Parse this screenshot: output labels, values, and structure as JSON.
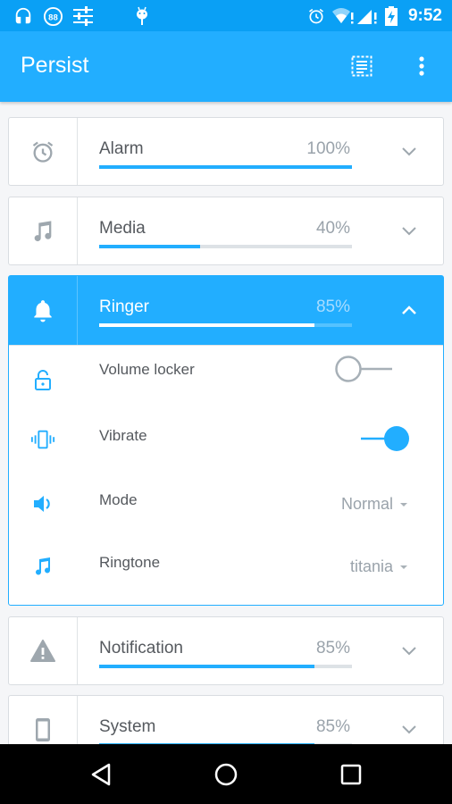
{
  "status_bar": {
    "time": "9:52",
    "notification_icons": [
      "headphones-icon",
      "88-badge-icon",
      "equalizer-icon",
      "android-icon"
    ],
    "badge_number": "88",
    "system_icons": [
      "alarm-icon",
      "wifi-icon",
      "signal-icon",
      "battery-charging-icon"
    ]
  },
  "app_bar": {
    "title": "Persist",
    "actions": [
      "select-all-icon",
      "more-vert-icon"
    ]
  },
  "accent_color": "#22aeff",
  "streams": [
    {
      "label": "Alarm",
      "percent_text": "100%",
      "value": 100,
      "icon": "alarm-icon",
      "expanded": false
    },
    {
      "label": "Media",
      "percent_text": "40%",
      "value": 40,
      "icon": "music-note-icon",
      "expanded": false
    },
    {
      "label": "Ringer",
      "percent_text": "85%",
      "value": 85,
      "icon": "bell-icon",
      "expanded": true
    },
    {
      "label": "Notification",
      "percent_text": "85%",
      "value": 85,
      "icon": "warning-icon",
      "expanded": false
    },
    {
      "label": "System",
      "percent_text": "85%",
      "value": 85,
      "icon": "phone-icon",
      "expanded": false
    }
  ],
  "ringer_settings": {
    "volume_locker": {
      "label": "Volume locker",
      "on": false
    },
    "vibrate": {
      "label": "Vibrate",
      "on": true
    },
    "mode": {
      "label": "Mode",
      "value": "Normal"
    },
    "ringtone": {
      "label": "Ringtone",
      "value": "titania"
    }
  },
  "nav_bar": [
    "back-icon",
    "home-icon",
    "recents-icon"
  ]
}
